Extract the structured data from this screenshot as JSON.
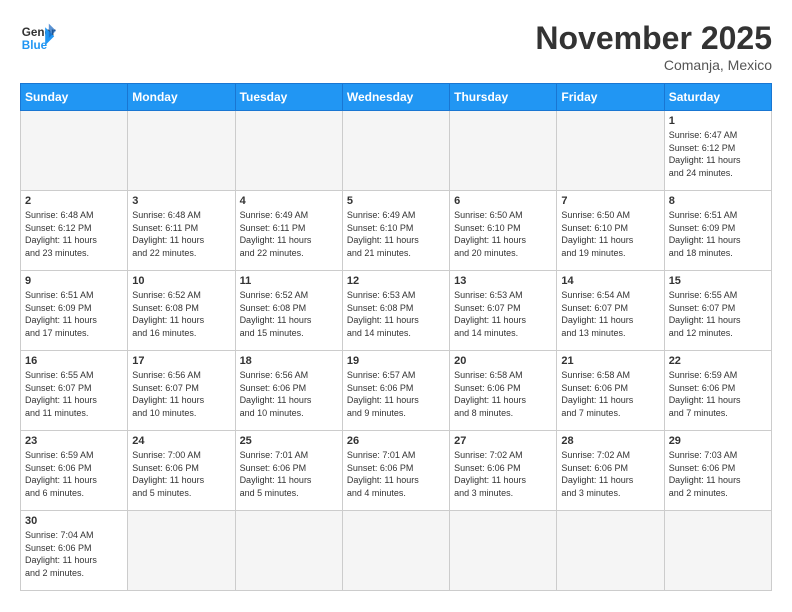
{
  "header": {
    "logo_general": "General",
    "logo_blue": "Blue",
    "month_title": "November 2025",
    "subtitle": "Comanja, Mexico"
  },
  "days_of_week": [
    "Sunday",
    "Monday",
    "Tuesday",
    "Wednesday",
    "Thursday",
    "Friday",
    "Saturday"
  ],
  "weeks": [
    [
      {
        "day": "",
        "info": ""
      },
      {
        "day": "",
        "info": ""
      },
      {
        "day": "",
        "info": ""
      },
      {
        "day": "",
        "info": ""
      },
      {
        "day": "",
        "info": ""
      },
      {
        "day": "",
        "info": ""
      },
      {
        "day": "1",
        "info": "Sunrise: 6:47 AM\nSunset: 6:12 PM\nDaylight: 11 hours\nand 24 minutes."
      }
    ],
    [
      {
        "day": "2",
        "info": "Sunrise: 6:48 AM\nSunset: 6:12 PM\nDaylight: 11 hours\nand 23 minutes."
      },
      {
        "day": "3",
        "info": "Sunrise: 6:48 AM\nSunset: 6:11 PM\nDaylight: 11 hours\nand 22 minutes."
      },
      {
        "day": "4",
        "info": "Sunrise: 6:49 AM\nSunset: 6:11 PM\nDaylight: 11 hours\nand 22 minutes."
      },
      {
        "day": "5",
        "info": "Sunrise: 6:49 AM\nSunset: 6:10 PM\nDaylight: 11 hours\nand 21 minutes."
      },
      {
        "day": "6",
        "info": "Sunrise: 6:50 AM\nSunset: 6:10 PM\nDaylight: 11 hours\nand 20 minutes."
      },
      {
        "day": "7",
        "info": "Sunrise: 6:50 AM\nSunset: 6:10 PM\nDaylight: 11 hours\nand 19 minutes."
      },
      {
        "day": "8",
        "info": "Sunrise: 6:51 AM\nSunset: 6:09 PM\nDaylight: 11 hours\nand 18 minutes."
      }
    ],
    [
      {
        "day": "9",
        "info": "Sunrise: 6:51 AM\nSunset: 6:09 PM\nDaylight: 11 hours\nand 17 minutes."
      },
      {
        "day": "10",
        "info": "Sunrise: 6:52 AM\nSunset: 6:08 PM\nDaylight: 11 hours\nand 16 minutes."
      },
      {
        "day": "11",
        "info": "Sunrise: 6:52 AM\nSunset: 6:08 PM\nDaylight: 11 hours\nand 15 minutes."
      },
      {
        "day": "12",
        "info": "Sunrise: 6:53 AM\nSunset: 6:08 PM\nDaylight: 11 hours\nand 14 minutes."
      },
      {
        "day": "13",
        "info": "Sunrise: 6:53 AM\nSunset: 6:07 PM\nDaylight: 11 hours\nand 14 minutes."
      },
      {
        "day": "14",
        "info": "Sunrise: 6:54 AM\nSunset: 6:07 PM\nDaylight: 11 hours\nand 13 minutes."
      },
      {
        "day": "15",
        "info": "Sunrise: 6:55 AM\nSunset: 6:07 PM\nDaylight: 11 hours\nand 12 minutes."
      }
    ],
    [
      {
        "day": "16",
        "info": "Sunrise: 6:55 AM\nSunset: 6:07 PM\nDaylight: 11 hours\nand 11 minutes."
      },
      {
        "day": "17",
        "info": "Sunrise: 6:56 AM\nSunset: 6:07 PM\nDaylight: 11 hours\nand 10 minutes."
      },
      {
        "day": "18",
        "info": "Sunrise: 6:56 AM\nSunset: 6:06 PM\nDaylight: 11 hours\nand 10 minutes."
      },
      {
        "day": "19",
        "info": "Sunrise: 6:57 AM\nSunset: 6:06 PM\nDaylight: 11 hours\nand 9 minutes."
      },
      {
        "day": "20",
        "info": "Sunrise: 6:58 AM\nSunset: 6:06 PM\nDaylight: 11 hours\nand 8 minutes."
      },
      {
        "day": "21",
        "info": "Sunrise: 6:58 AM\nSunset: 6:06 PM\nDaylight: 11 hours\nand 7 minutes."
      },
      {
        "day": "22",
        "info": "Sunrise: 6:59 AM\nSunset: 6:06 PM\nDaylight: 11 hours\nand 7 minutes."
      }
    ],
    [
      {
        "day": "23",
        "info": "Sunrise: 6:59 AM\nSunset: 6:06 PM\nDaylight: 11 hours\nand 6 minutes."
      },
      {
        "day": "24",
        "info": "Sunrise: 7:00 AM\nSunset: 6:06 PM\nDaylight: 11 hours\nand 5 minutes."
      },
      {
        "day": "25",
        "info": "Sunrise: 7:01 AM\nSunset: 6:06 PM\nDaylight: 11 hours\nand 5 minutes."
      },
      {
        "day": "26",
        "info": "Sunrise: 7:01 AM\nSunset: 6:06 PM\nDaylight: 11 hours\nand 4 minutes."
      },
      {
        "day": "27",
        "info": "Sunrise: 7:02 AM\nSunset: 6:06 PM\nDaylight: 11 hours\nand 3 minutes."
      },
      {
        "day": "28",
        "info": "Sunrise: 7:02 AM\nSunset: 6:06 PM\nDaylight: 11 hours\nand 3 minutes."
      },
      {
        "day": "29",
        "info": "Sunrise: 7:03 AM\nSunset: 6:06 PM\nDaylight: 11 hours\nand 2 minutes."
      }
    ],
    [
      {
        "day": "30",
        "info": "Sunrise: 7:04 AM\nSunset: 6:06 PM\nDaylight: 11 hours\nand 2 minutes."
      },
      {
        "day": "",
        "info": ""
      },
      {
        "day": "",
        "info": ""
      },
      {
        "day": "",
        "info": ""
      },
      {
        "day": "",
        "info": ""
      },
      {
        "day": "",
        "info": ""
      },
      {
        "day": "",
        "info": ""
      }
    ]
  ]
}
